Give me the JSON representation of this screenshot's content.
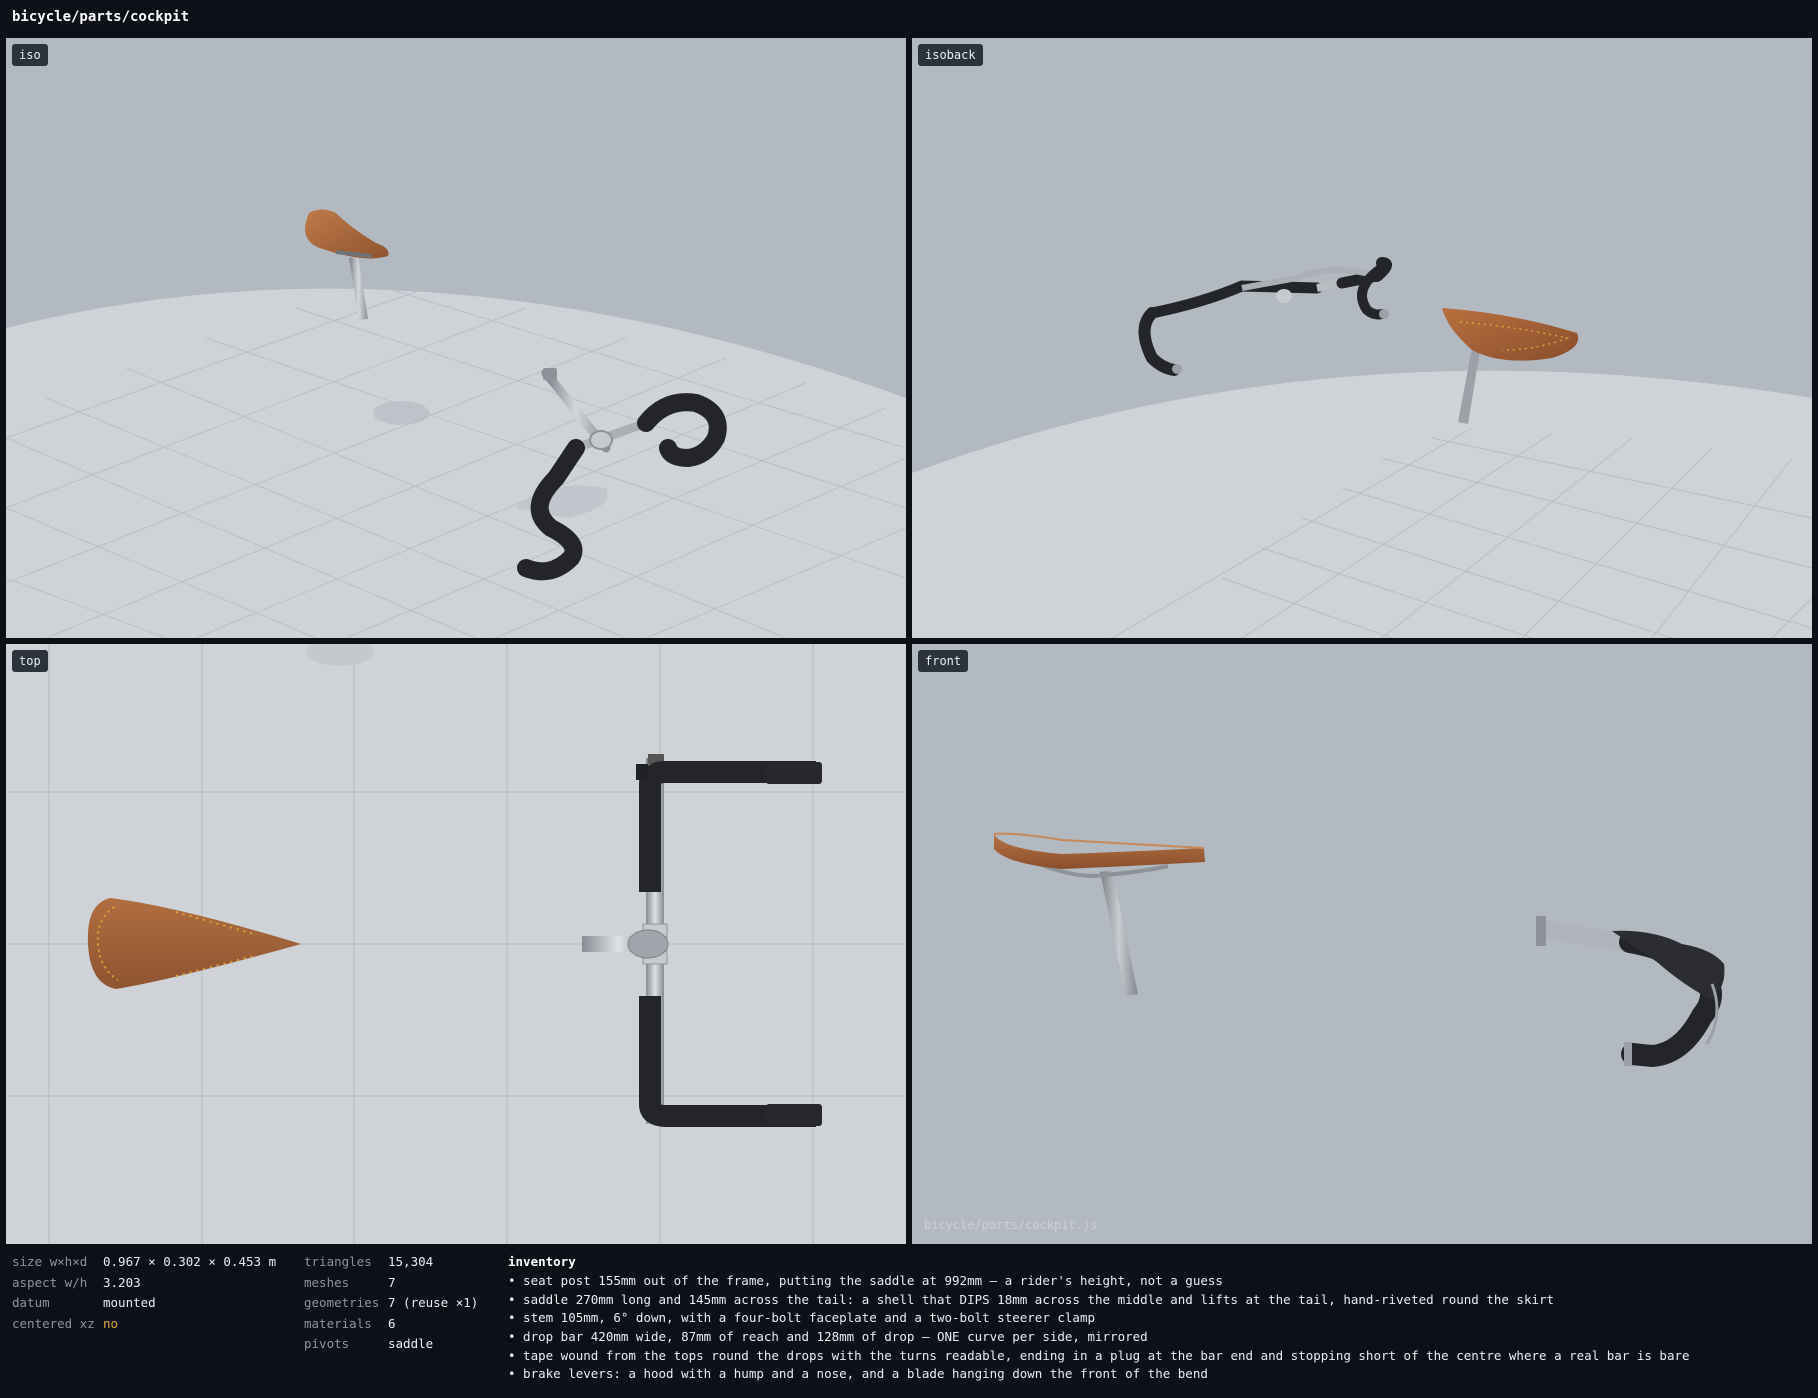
{
  "title": "bicycle/parts/cockpit",
  "viewports": {
    "iso": {
      "label": "iso"
    },
    "isoback": {
      "label": "isoback"
    },
    "top": {
      "label": "top"
    },
    "front": {
      "label": "front",
      "watermark": "bicycle/parts/cockpit.js"
    }
  },
  "stats_left": [
    {
      "key": "size w×h×d",
      "value": "0.967 × 0.302 × 0.453 m"
    },
    {
      "key": "aspect w/h",
      "value": "3.203"
    },
    {
      "key": "datum",
      "value": "mounted"
    },
    {
      "key": "centered xz",
      "value": "no"
    }
  ],
  "stats_right": [
    {
      "key": "triangles",
      "value": "15,304"
    },
    {
      "key": "meshes",
      "value": "7"
    },
    {
      "key": "geometries",
      "value": "7 (reuse ×1)"
    },
    {
      "key": "materials",
      "value": "6"
    },
    {
      "key": "pivots",
      "value": "saddle"
    }
  ],
  "inventory": {
    "heading": "inventory",
    "items": [
      "• seat post 155mm out of the frame, putting the saddle at 992mm — a rider's height, not a guess",
      "• saddle 270mm long and 145mm across the tail: a shell that DIPS 18mm across the middle and lifts at the tail, hand-riveted round the skirt",
      "• stem 105mm, 6° down, with a four-bolt faceplate and a two-bolt steerer clamp",
      "• drop bar 420mm wide, 87mm of reach and 128mm of drop — ONE curve per side, mirrored",
      "• tape wound from the tops round the drops with the turns readable, ending in a plug at the bar end and stopping short of the centre where a real bar is bare",
      "• brake levers: a hood with a hump and a nose, and a blade hanging down the front of the bend"
    ]
  },
  "colors": {
    "background": "#0d1117",
    "sky": "#b2b8c0",
    "ground": "#cfd3d8",
    "leather": "#a0623a",
    "tape": "#1f2124",
    "metal": "#a7adb3",
    "warning": "#e3a43a"
  }
}
